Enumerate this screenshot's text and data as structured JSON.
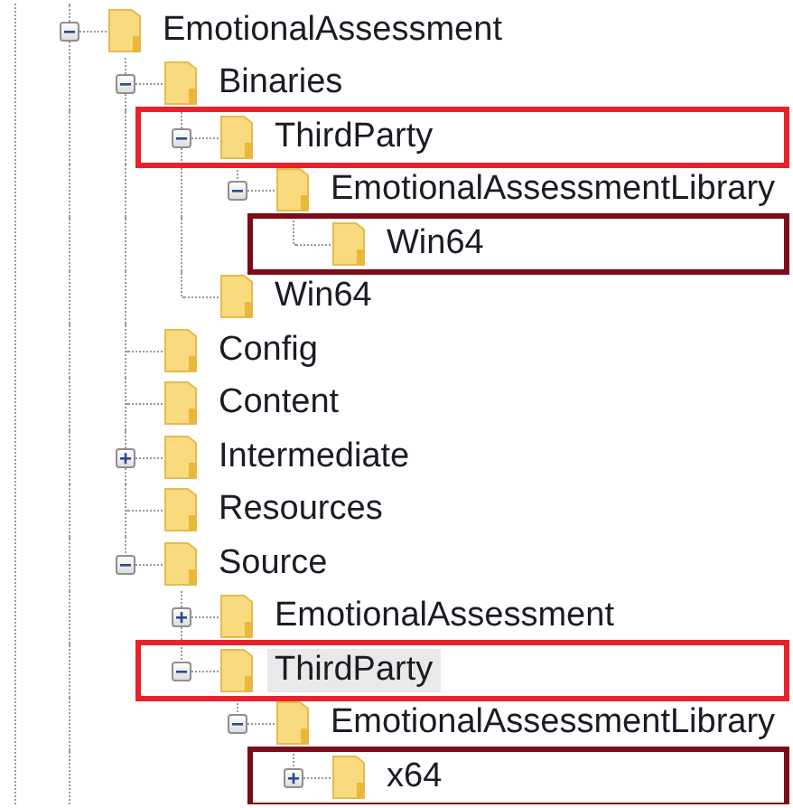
{
  "tree": [
    {
      "label": "EmotionalAssessment",
      "expanded": true,
      "selected": false,
      "children": [
        {
          "label": "Binaries",
          "expanded": true,
          "selected": false,
          "children": [
            {
              "label": "ThirdParty",
              "expanded": true,
              "selected": false,
              "color": "#e8212b",
              "children": [
                {
                  "label": "EmotionalAssessmentLibrary",
                  "expanded": true,
                  "selected": false,
                  "children": [
                    {
                      "label": "Win64",
                      "selected": false,
                      "color": "#7b0c18"
                    }
                  ]
                }
              ]
            },
            {
              "label": "Win64",
              "selected": false
            }
          ]
        },
        {
          "label": "Config",
          "selected": false
        },
        {
          "label": "Content",
          "selected": false
        },
        {
          "label": "Intermediate",
          "expanded": false,
          "selected": false
        },
        {
          "label": "Resources",
          "selected": false
        },
        {
          "label": "Source",
          "expanded": true,
          "selected": false,
          "children": [
            {
              "label": "EmotionalAssessment",
              "expanded": false,
              "selected": false
            },
            {
              "label": "ThirdParty",
              "expanded": true,
              "selected": true,
              "color": "#e8212b",
              "children": [
                {
                  "label": "EmotionalAssessmentLibrary",
                  "expanded": true,
                  "selected": false,
                  "children": [
                    {
                      "label": "x64",
                      "expanded": false,
                      "selected": false,
                      "color": "#7b0c18"
                    }
                  ]
                }
              ]
            }
          ]
        }
      ]
    }
  ]
}
